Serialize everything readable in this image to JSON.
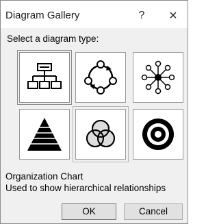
{
  "dialog": {
    "title": "Diagram Gallery",
    "help_label": "?",
    "close_label": "×",
    "prompt": "Select a diagram type:",
    "diagram_types": [
      {
        "icon": "organization-chart-icon"
      },
      {
        "icon": "cycle-diagram-icon"
      },
      {
        "icon": "radial-diagram-icon"
      },
      {
        "icon": "pyramid-diagram-icon"
      },
      {
        "icon": "venn-diagram-icon"
      },
      {
        "icon": "target-diagram-icon"
      }
    ],
    "selected_name": "Organization Chart",
    "selected_description": "Used to show hierarchical relationships",
    "ok_label": "OK",
    "cancel_label": "Cancel"
  }
}
